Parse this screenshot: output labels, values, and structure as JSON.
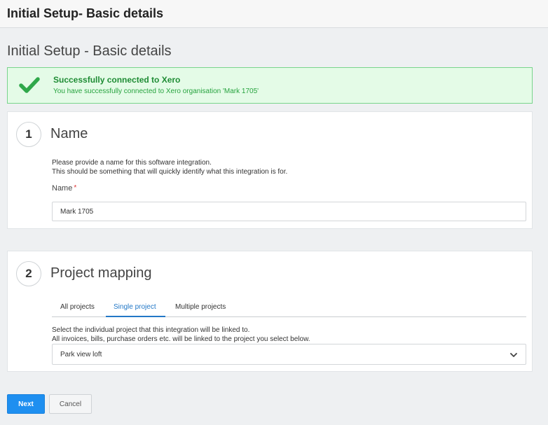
{
  "header": {
    "title": "Initial Setup- Basic details"
  },
  "page": {
    "title": "Initial Setup - Basic details"
  },
  "alert": {
    "icon": "check-icon",
    "color": "#2fa84a",
    "title": "Successfully connected to Xero",
    "message": "You have successfully connected to Xero organisation 'Mark 1705'"
  },
  "step1": {
    "number": "1",
    "title": "Name",
    "desc_line1": "Please provide a name for this software integration.",
    "desc_line2": "This should be something that will quickly identify what this integration is for.",
    "field_label": "Name",
    "required_mark": "*",
    "field_value": "Mark 1705"
  },
  "step2": {
    "number": "2",
    "title": "Project mapping",
    "tabs": [
      {
        "label": "All projects"
      },
      {
        "label": "Single project"
      },
      {
        "label": "Multiple projects"
      }
    ],
    "active_tab": "Single project",
    "desc_line1": "Select the individual project that this integration will be linked to.",
    "desc_line2": "All invoices, bills, purchase orders etc. will be linked to the project you select below.",
    "select_value": "Park view loft",
    "select_icon": "chevron-down-icon"
  },
  "actions": {
    "next_label": "Next",
    "cancel_label": "Cancel",
    "accent": "#1e8ff0"
  }
}
